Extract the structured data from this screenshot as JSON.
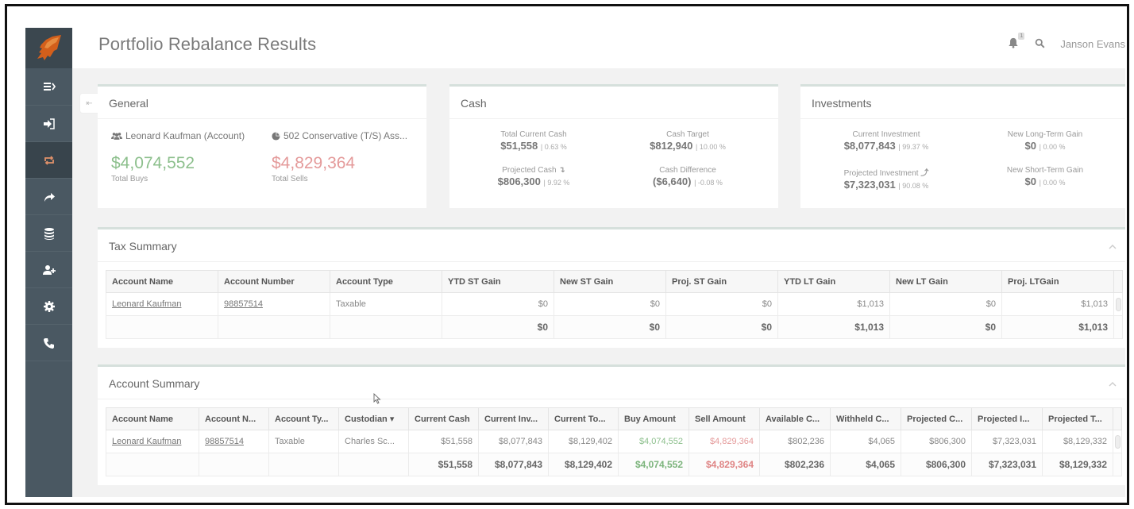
{
  "header": {
    "title": "Portfolio Rebalance Results",
    "notification_count": "1",
    "user_name": "Janson Evans"
  },
  "sidebar": {
    "items": [
      {
        "icon": "menu-expand-icon",
        "label": "Expand menu"
      },
      {
        "icon": "sign-in-icon",
        "label": "Sign in"
      },
      {
        "icon": "rebalance-icon",
        "label": "Rebalance",
        "active": true
      },
      {
        "icon": "share-icon",
        "label": "Share"
      },
      {
        "icon": "database-icon",
        "label": "Database"
      },
      {
        "icon": "add-user-icon",
        "label": "Add user"
      },
      {
        "icon": "gear-icon",
        "label": "Settings"
      },
      {
        "icon": "phone-icon",
        "label": "Contact"
      }
    ]
  },
  "general": {
    "title": "General",
    "account_label": "Leonard Kaufman (Account)",
    "model_label": "502 Conservative (T/S) Ass...",
    "total_buys": "$4,074,552",
    "total_buys_label": "Total Buys",
    "total_sells": "$4,829,364",
    "total_sells_label": "Total Sells"
  },
  "cash": {
    "title": "Cash",
    "metrics": [
      {
        "label": "Total Current Cash",
        "value": "$51,558",
        "pct": "0.63 %"
      },
      {
        "label": "Cash Target",
        "value": "$812,940",
        "pct": "10.00 %"
      },
      {
        "label": "Projected Cash",
        "arrow": "↴",
        "value": "$806,300",
        "pct": "9.92 %"
      },
      {
        "label": "Cash Difference",
        "value": "($6,640)",
        "pct": "-0.08 %"
      }
    ]
  },
  "investments": {
    "title": "Investments",
    "metrics": [
      {
        "label": "Current Investment",
        "value": "$8,077,843",
        "pct": "99.37 %"
      },
      {
        "label": "New Long-Term Gain",
        "value": "$0",
        "pct": "0.00 %"
      },
      {
        "label": "Projected Investment",
        "arrow": "⤴",
        "value": "$7,323,031",
        "pct": "90.08 %"
      },
      {
        "label": "New Short-Term Gain",
        "value": "$0",
        "pct": "0.00 %"
      }
    ]
  },
  "tax_summary": {
    "title": "Tax Summary",
    "columns": [
      "Account Name",
      "Account Number",
      "Account Type",
      "YTD ST Gain",
      "New ST Gain",
      "Proj. ST Gain",
      "YTD LT Gain",
      "New LT Gain",
      "Proj. LTGain"
    ],
    "rows": [
      [
        "Leonard Kaufman",
        "98857514",
        "Taxable",
        "$0",
        "$0",
        "$0",
        "$1,013",
        "$0",
        "$1,013"
      ]
    ],
    "totals": [
      "",
      "",
      "",
      "$0",
      "$0",
      "$0",
      "$1,013",
      "$0",
      "$1,013"
    ]
  },
  "account_summary": {
    "title": "Account Summary",
    "columns": [
      "Account Name",
      "Account N...",
      "Account Ty...",
      "Custodian ▾",
      "Current Cash",
      "Current Inv...",
      "Current To...",
      "Buy Amount",
      "Sell Amount",
      "Available C...",
      "Withheld C...",
      "Projected C...",
      "Projected I...",
      "Projected T..."
    ],
    "rows": [
      [
        "Leonard Kaufman",
        "98857514",
        "Taxable",
        "Charles Sc...",
        "$51,558",
        "$8,077,843",
        "$8,129,402",
        "$4,074,552",
        "$4,829,364",
        "$802,236",
        "$4,065",
        "$806,300",
        "$7,323,031",
        "$8,129,332"
      ]
    ],
    "totals": [
      "",
      "",
      "",
      "",
      "$51,558",
      "$8,077,843",
      "$8,129,402",
      "$4,074,552",
      "$4,829,364",
      "$802,236",
      "$4,065",
      "$806,300",
      "$7,323,031",
      "$8,129,332"
    ]
  },
  "colors": {
    "sidebar": "#4a5862",
    "sidebar_active": "#38444c",
    "buy_green": "#8cbf8c",
    "sell_red": "#e49a9a",
    "card_accent": "#d6e0dc"
  }
}
